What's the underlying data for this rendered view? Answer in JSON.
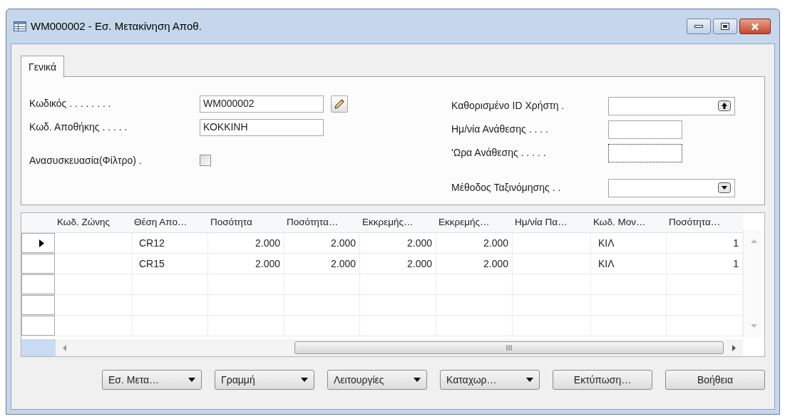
{
  "window": {
    "title": "WM000002 - Εσ. Μετακίνηση Αποθ."
  },
  "tabs": [
    {
      "label": "Γενικά",
      "selected": true
    }
  ],
  "fields_left": [
    {
      "kind": "text",
      "label": "Κωδικός . . . . . . . .",
      "value": "WM000002",
      "edit_button": true
    },
    {
      "kind": "text",
      "label": "Κωδ. Αποθήκης . . . . .",
      "value": "ΚΟΚΚΙΝΗ",
      "edit_button": false
    },
    {
      "kind": "checkbox",
      "label": "Ανασυσκευασία(Φίλτρο) .",
      "checked": false
    }
  ],
  "fields_right": [
    {
      "kind": "lookup",
      "label": "Καθορισμένο ID Χρήστη .",
      "focused": false
    },
    {
      "kind": "short",
      "label": "Ημ/νία Ανάθεσης . . . .",
      "focused": false
    },
    {
      "kind": "short",
      "label": "'Ωρα Ανάθεσης . . . . .",
      "focused": true
    },
    {
      "kind": "dropdown",
      "label": "Μέθοδος Ταξινόμησης . .",
      "focused": false
    }
  ],
  "grid": {
    "columns": [
      {
        "label": "Κωδ. Ζώνης",
        "kind": "text"
      },
      {
        "label": "Θέση Απο…",
        "kind": "text"
      },
      {
        "label": "Ποσότητα",
        "kind": "number"
      },
      {
        "label": "Ποσότητα…",
        "kind": "number"
      },
      {
        "label": "Εκκρεμής…",
        "kind": "number"
      },
      {
        "label": "Εκκρεμής…",
        "kind": "number"
      },
      {
        "label": "Ημ/νία Πα…",
        "kind": "text"
      },
      {
        "label": "Κωδ. Μον…",
        "kind": "text"
      },
      {
        "label": "Ποσότητα…",
        "kind": "number"
      }
    ],
    "rows": [
      {
        "current": true,
        "cells": [
          null,
          "CR12",
          "2.000",
          "2.000",
          "2.000",
          "2.000",
          null,
          "ΚΙΛ",
          "1"
        ]
      },
      {
        "current": false,
        "cells": [
          null,
          "CR15",
          "2.000",
          "2.000",
          "2.000",
          "2.000",
          null,
          "ΚΙΛ",
          "1"
        ]
      }
    ]
  },
  "buttons": [
    {
      "label": "Εσ. Μετα…",
      "dropdown": true
    },
    {
      "label": "Γραμμή",
      "dropdown": true
    },
    {
      "label": "Λειτουργίες",
      "dropdown": true
    },
    {
      "label": "Καταχωρ…",
      "dropdown": true
    },
    {
      "label": "Εκτύπωση…",
      "dropdown": false
    },
    {
      "label": "Βοήθεια",
      "dropdown": false
    }
  ]
}
